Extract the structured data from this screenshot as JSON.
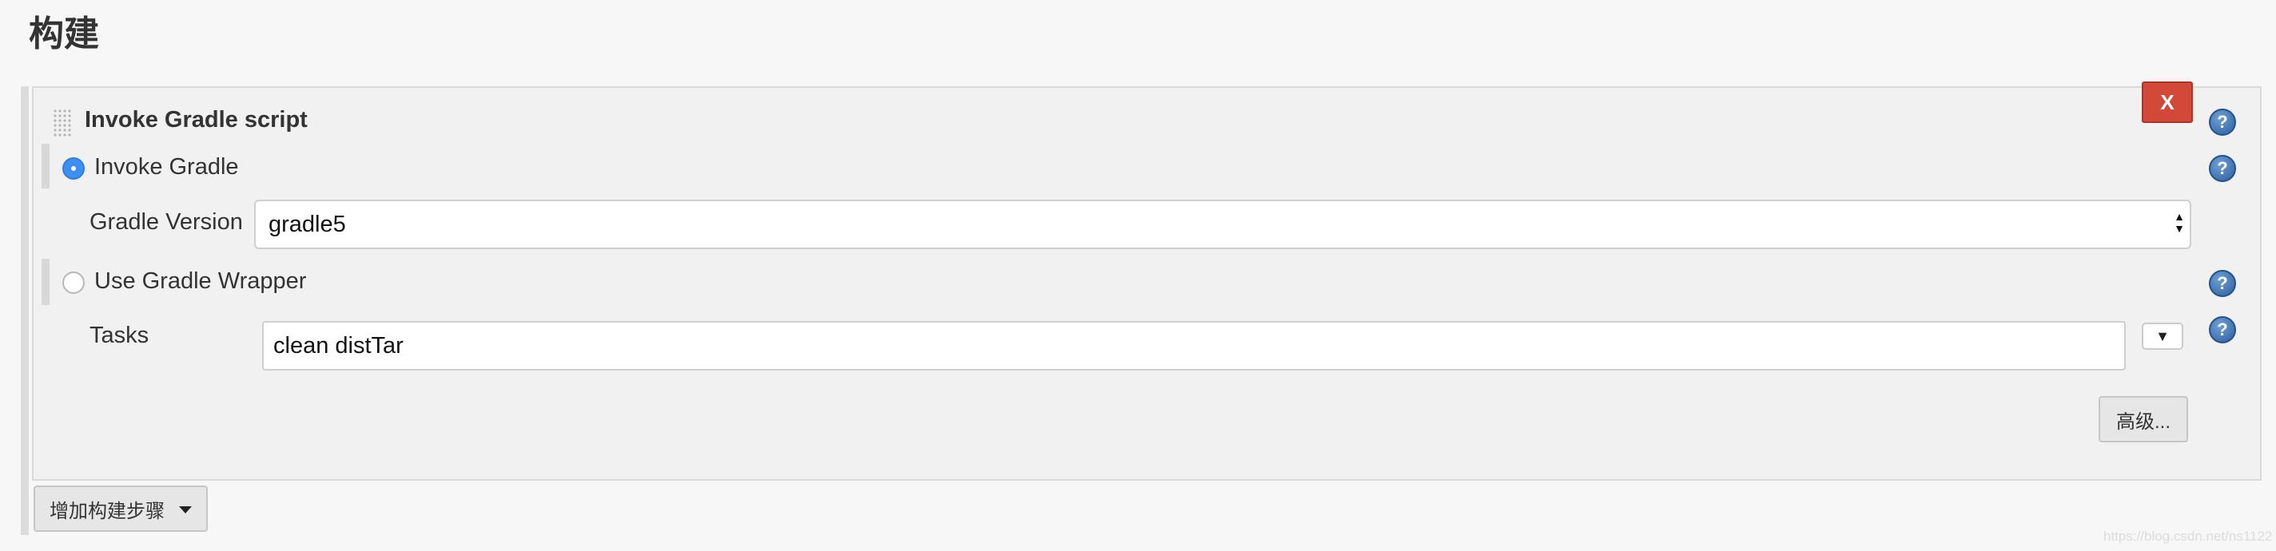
{
  "section": {
    "title": "构建"
  },
  "step": {
    "title": "Invoke Gradle script",
    "delete_label": "X"
  },
  "options": {
    "invoke_gradle_label": "Invoke Gradle",
    "invoke_gradle_selected": true,
    "gradle_version_label": "Gradle Version",
    "gradle_version_value": "gradle5",
    "use_wrapper_label": "Use Gradle Wrapper",
    "use_wrapper_selected": false
  },
  "tasks": {
    "label": "Tasks",
    "value": "clean distTar",
    "expand_glyph": "▼"
  },
  "buttons": {
    "advanced_label": "高级...",
    "add_step_label": "增加构建步骤"
  },
  "help": {
    "glyph": "?"
  },
  "watermark": "https://blog.csdn.net/ns1122",
  "colors": {
    "delete_button": "#d24939",
    "radio_selected": "#3d8ff4",
    "help_icon": "#2c5f9e",
    "panel_background": "#f1f1f1"
  }
}
